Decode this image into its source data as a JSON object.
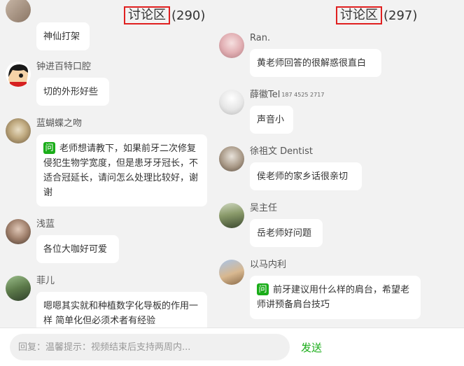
{
  "left_panel": {
    "title": "讨论区",
    "count": "(290)",
    "messages": [
      {
        "name": "",
        "text": "神仙打架"
      },
      {
        "name": "钟进百特口腔",
        "text": "切的外形好些"
      },
      {
        "name": "蓝蝴蝶之吻",
        "badge": "问",
        "text": "老师想请教下，如果前牙二次修复侵犯生物学宽度，但是患牙牙冠长，不适合冠延长，请问怎么处理比较好，谢谢"
      },
      {
        "name": "浅蓝",
        "text": "各位大咖好可爱"
      },
      {
        "name": "菲儿",
        "text": "嗯嗯其实就和种植数字化导板的作用一样 简单化但必须术者有经验"
      }
    ]
  },
  "right_panel": {
    "title": "讨论区",
    "count": "(297)",
    "messages": [
      {
        "name": "Ran.",
        "text": "黄老师回答的很解惑很直白"
      },
      {
        "name": "薛徽Tel",
        "phone": "187 4525 2717",
        "text": "声音小"
      },
      {
        "name": "徐祖文 Dentist",
        "text": "侯老师的家乡话很亲切"
      },
      {
        "name": "吴主任",
        "text": "岳老师好问题"
      },
      {
        "name": "以马内利",
        "badge": "问",
        "text": "前牙建议用什么样的肩台，希望老师讲预备肩台技巧"
      }
    ]
  },
  "footer": {
    "placeholder": "回复：温馨提示：视频结束后支持两周内...",
    "send_label": "发送"
  },
  "colors": {
    "accent_green": "#1aad19",
    "highlight_red": "#e02020",
    "background": "#f2f2f2"
  }
}
